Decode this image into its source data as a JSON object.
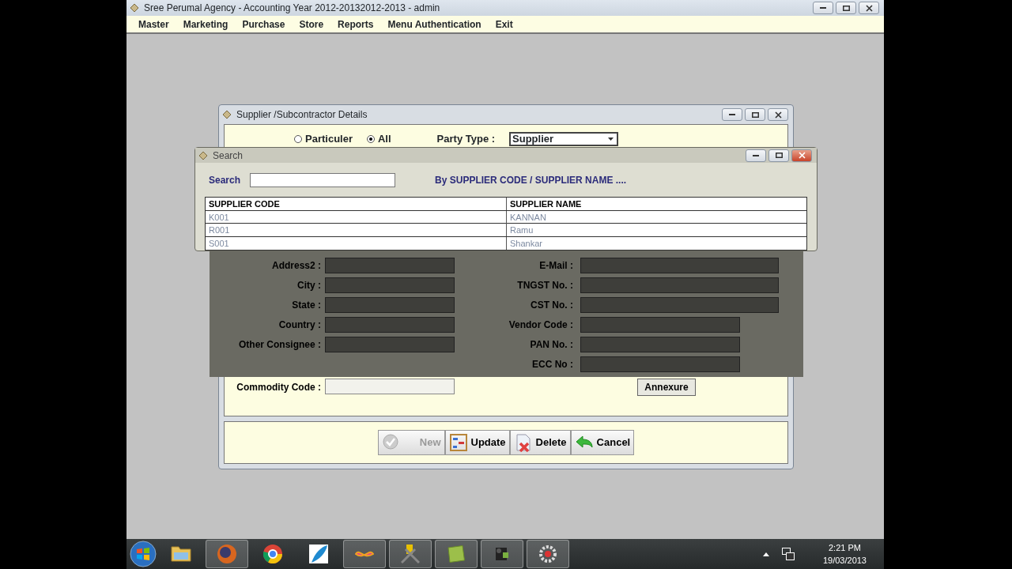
{
  "window": {
    "title": "Sree Perumal Agency - Accounting Year 2012-20132012-2013 - admin"
  },
  "menu": [
    {
      "label": "Master"
    },
    {
      "label": "Marketing"
    },
    {
      "label": "Purchase"
    },
    {
      "label": "Store"
    },
    {
      "label": "Reports"
    },
    {
      "label": "Menu Authentication"
    },
    {
      "label": "Exit"
    }
  ],
  "supplier_dialog": {
    "title": "Supplier /Subcontractor Details",
    "party_filter": [
      {
        "label": "Particuler",
        "selected": false
      },
      {
        "label": "All",
        "selected": true
      }
    ],
    "party_type": {
      "label": "Party Type :",
      "value": "Supplier"
    },
    "rows": [
      {
        "dimmed": true,
        "left": {
          "label": "Address2 :"
        },
        "right": {
          "label": "E-Mail :",
          "kind": "long-text"
        }
      },
      {
        "dimmed": true,
        "left": {
          "label": "City :"
        },
        "right": {
          "label": "TNGST No. :",
          "kind": "long-text"
        }
      },
      {
        "dimmed": true,
        "left": {
          "label": "State :"
        },
        "right": {
          "label": "CST No. :",
          "kind": "long-text"
        }
      },
      {
        "dimmed": true,
        "left": {
          "label": "Country :"
        },
        "right": {
          "label": "Vendor Code :",
          "kind": "text"
        }
      },
      {
        "dimmed": true,
        "left": {
          "label": "Other Consignee :"
        },
        "right": {
          "label": "PAN No. :",
          "kind": "text"
        }
      },
      {
        "dimmed": true,
        "right": {
          "label": "ECC No :",
          "kind": "text"
        }
      },
      {
        "dimmed": false,
        "left": {
          "label": "Commodity  Code :"
        },
        "right": {
          "label": "Annexure",
          "kind": "button"
        }
      }
    ],
    "buttons": [
      {
        "label": "New",
        "kind": "check",
        "disabled": true
      },
      {
        "label": "Update",
        "kind": "abacus",
        "disabled": false
      },
      {
        "label": "Delete",
        "kind": "delete",
        "disabled": false
      },
      {
        "label": "Cancel",
        "kind": "undo",
        "disabled": false
      }
    ]
  },
  "search_dialog": {
    "title": "Search",
    "search_label": "Search",
    "hint": "By SUPPLIER CODE  / SUPPLIER NAME ....",
    "columns": [
      "SUPPLIER CODE",
      "SUPPLIER NAME"
    ],
    "rows": [
      [
        "K001",
        "KANNAN"
      ],
      [
        "R001",
        "Ramu"
      ],
      [
        "S001",
        "Shankar"
      ]
    ]
  },
  "taskbar": {
    "apps": [
      {
        "kind": "folder",
        "running": false
      },
      {
        "kind": "globe",
        "running": true
      },
      {
        "kind": "chrome",
        "running": false
      },
      {
        "kind": "feather",
        "running": false
      },
      {
        "kind": "studio",
        "running": true
      },
      {
        "kind": "tools",
        "running": true
      },
      {
        "kind": "sheet",
        "running": true
      },
      {
        "kind": "camera",
        "running": true
      },
      {
        "kind": "gear",
        "running": true
      }
    ],
    "time": "2:21 PM",
    "date": "19/03/2013"
  }
}
